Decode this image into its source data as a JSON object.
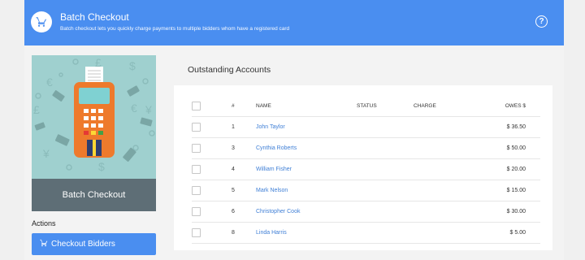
{
  "header": {
    "title": "Batch Checkout",
    "subtitle": "Batch checkout lets you quickly charge payments to multiple bidders whom have a registered card"
  },
  "sidebar": {
    "caption": "Batch Checkout",
    "actions_label": "Actions",
    "checkout_button": "Checkout Bidders"
  },
  "panel": {
    "title": "Outstanding Accounts",
    "columns": {
      "num": "#",
      "name": "NAME",
      "status": "STATUS",
      "charge": "CHARGE",
      "owes": "OWES $"
    },
    "rows": [
      {
        "num": "1",
        "name": "John Taylor",
        "status": "",
        "charge": "",
        "owes": "$ 36.50"
      },
      {
        "num": "3",
        "name": "Cynthia Roberts",
        "status": "",
        "charge": "",
        "owes": "$ 50.00"
      },
      {
        "num": "4",
        "name": "William Fisher",
        "status": "",
        "charge": "",
        "owes": "$ 20.00"
      },
      {
        "num": "5",
        "name": "Mark Nelson",
        "status": "",
        "charge": "",
        "owes": "$ 15.00"
      },
      {
        "num": "6",
        "name": "Christopher Cook",
        "status": "",
        "charge": "",
        "owes": "$ 30.00"
      },
      {
        "num": "8",
        "name": "Linda Harris",
        "status": "",
        "charge": "",
        "owes": "$ 5.00"
      }
    ]
  },
  "icons": {
    "header": "cart-icon",
    "help": "help-circle-icon",
    "button": "cart-icon"
  },
  "colors": {
    "accent": "#4a8ef0",
    "sidebar_bg": "#9fd0cf",
    "caption_bg": "#5e6e76",
    "link": "#3f7fd6"
  }
}
